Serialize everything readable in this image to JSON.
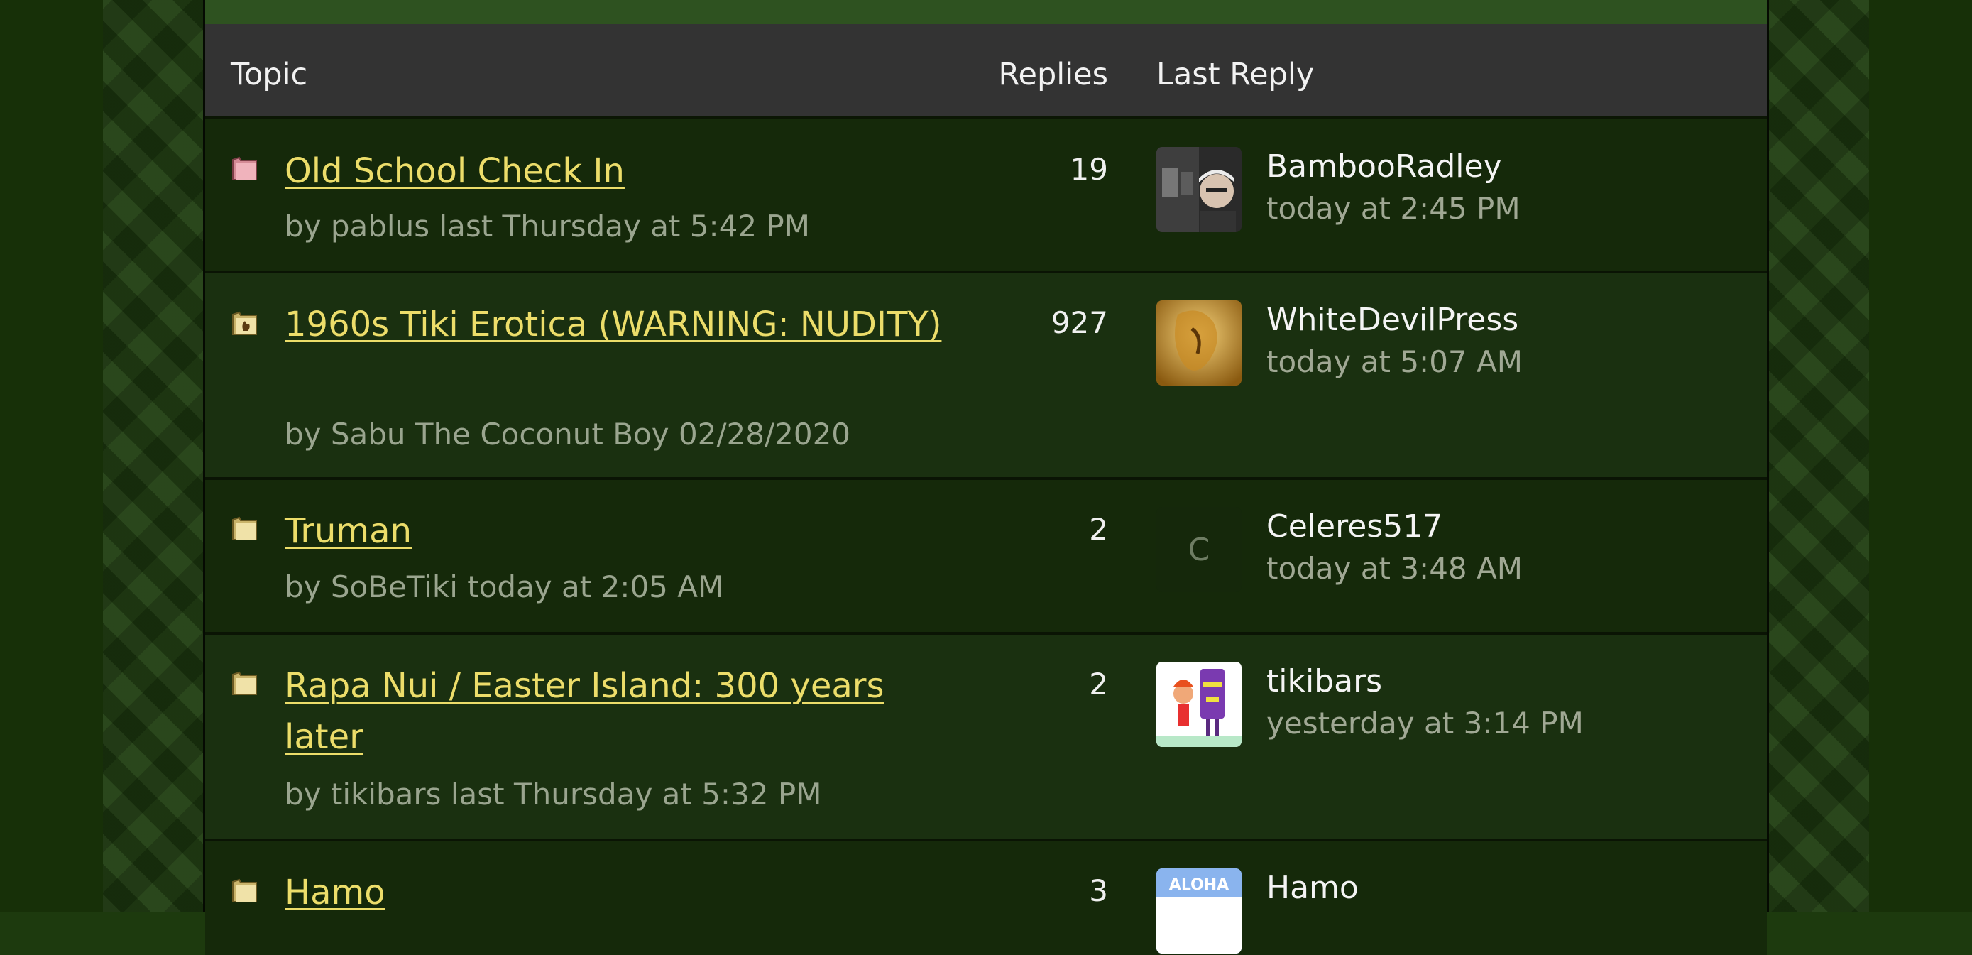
{
  "columns": {
    "topic": "Topic",
    "replies": "Replies",
    "last_reply": "Last Reply"
  },
  "topics": [
    {
      "title": "Old School Check In",
      "byline": "by pablus last Thursday at 5:42 PM",
      "replies": "19",
      "last_user": "BambooRadley",
      "last_time": "today at 2:45 PM",
      "icon": "folder-pink-icon"
    },
    {
      "title": "1960s Tiki Erotica (WARNING: NUDITY)",
      "byline": "by Sabu The Coconut Boy 02/28/2020",
      "replies": "927",
      "last_user": "WhiteDevilPress",
      "last_time": "today at 5:07 AM",
      "icon": "folder-hot-icon"
    },
    {
      "title": "Truman",
      "byline": "by SoBeTiki today at 2:05 AM",
      "replies": "2",
      "last_user": "Celeres517",
      "last_time": "today at 3:48 AM",
      "avatar_letter": "C",
      "icon": "folder-icon"
    },
    {
      "title": "Rapa Nui / Easter Island: 300 years later",
      "byline": "by tikibars last Thursday at 5:32 PM",
      "replies": "2",
      "last_user": "tikibars",
      "last_time": "yesterday at 3:14 PM",
      "icon": "folder-icon"
    },
    {
      "title": "Hamo",
      "replies": "3",
      "last_user": "Hamo",
      "avatar_text": "ALOHA",
      "icon": "folder-icon"
    }
  ],
  "colors": {
    "link": "#ecdd6a",
    "header_bg": "#333333",
    "row_bg": "#15290a"
  }
}
